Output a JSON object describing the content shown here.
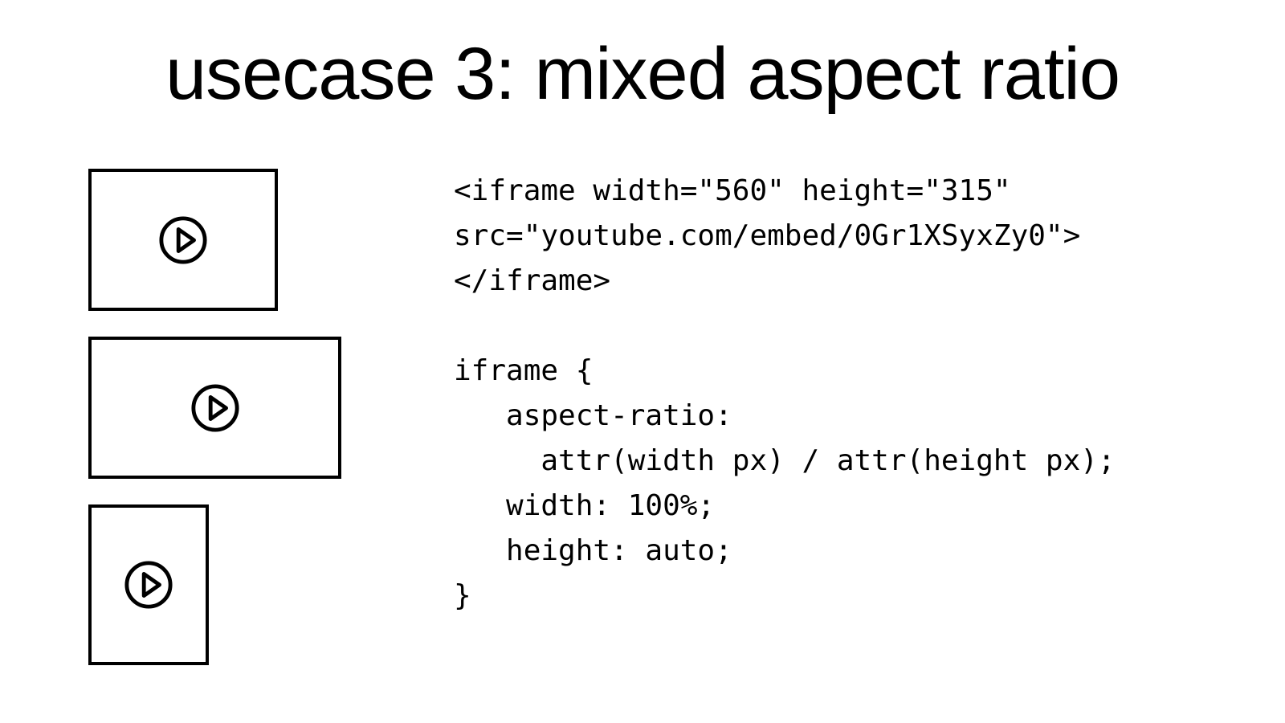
{
  "title": "usecase 3: mixed aspect ratio",
  "code": {
    "html_block": "<iframe width=\"560\" height=\"315\"\nsrc=\"youtube.com/embed/0Gr1XSyxZy0\">\n</iframe>",
    "css_block": "iframe {\n   aspect-ratio:\n     attr(width px) / attr(height px);\n   width: 100%;\n   height: auto;\n}"
  },
  "thumbnails": [
    {
      "icon": "play-icon"
    },
    {
      "icon": "play-icon"
    },
    {
      "icon": "play-icon"
    }
  ]
}
